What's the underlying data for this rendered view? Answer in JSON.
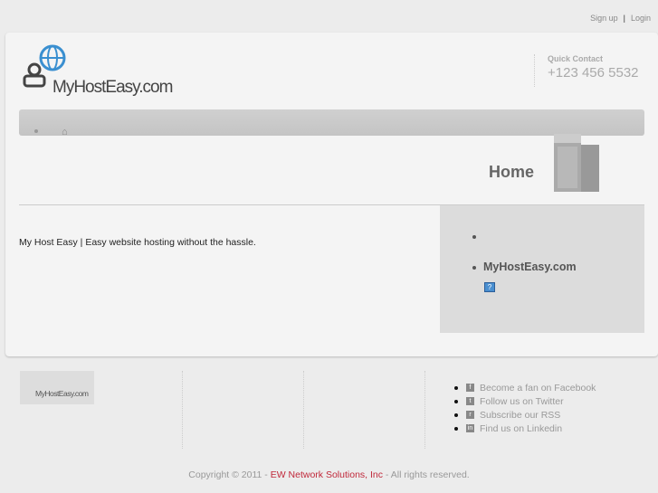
{
  "top": {
    "signup": "Sign up",
    "sep": "|",
    "login": "Login"
  },
  "logo": {
    "text": "MyHostEasy.com"
  },
  "contact": {
    "label": "Quick Contact",
    "phone": "+123 456 5532"
  },
  "page": {
    "title": "Home",
    "intro": "My Host Easy | Easy website  hosting without the hassle."
  },
  "sidebar": {
    "link": "MyHostEasy.com",
    "icon_text": "?"
  },
  "footer": {
    "logo_text": "MyHostEasy.com",
    "social": [
      {
        "icon": "f",
        "label": "Become a fan on Facebook"
      },
      {
        "icon": "t",
        "label": "Follow us on Twitter"
      },
      {
        "icon": "r",
        "label": "Subscribe our RSS"
      },
      {
        "icon": "in",
        "label": "Find us on Linkedin"
      }
    ],
    "copy_pre": "Copyright © 2011 - ",
    "copy_link": "EW Network Solutions, Inc",
    "copy_post": " - All rights reserved."
  }
}
